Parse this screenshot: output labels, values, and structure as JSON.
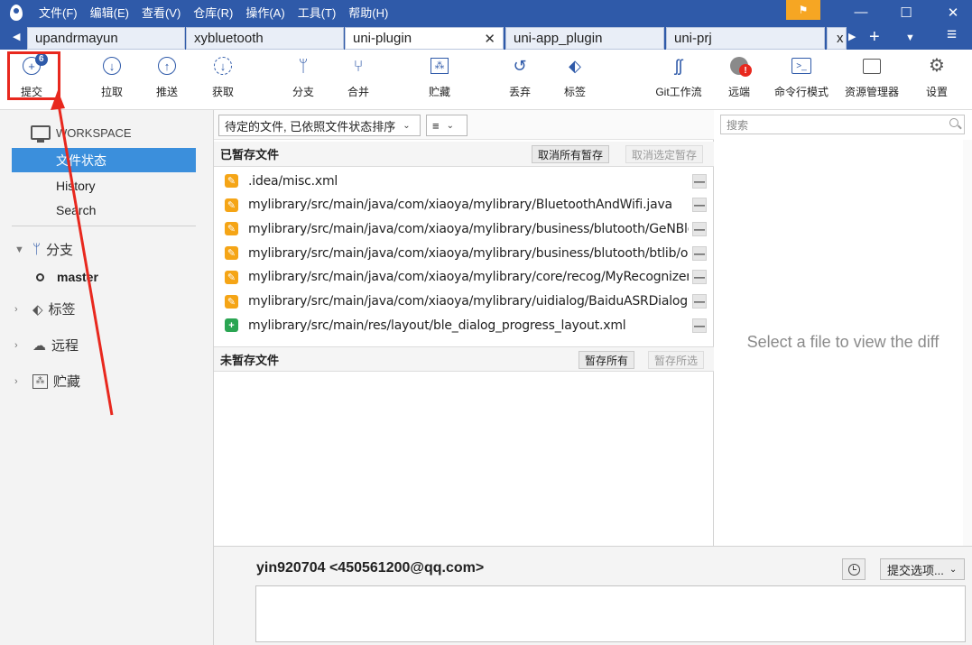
{
  "menu": [
    "文件(F)",
    "编辑(E)",
    "查看(V)",
    "仓库(R)",
    "操作(A)",
    "工具(T)",
    "帮助(H)"
  ],
  "window_buttons": {
    "minimize": "—",
    "maximize": "☐",
    "close": "✕"
  },
  "tabs": [
    {
      "label": "upandrmayun",
      "active": false
    },
    {
      "label": "xybluetooth",
      "active": false
    },
    {
      "label": "uni-plugin",
      "active": true
    },
    {
      "label": "uni-app_plugin",
      "active": false
    },
    {
      "label": "uni-prj",
      "active": false
    },
    {
      "label": "x",
      "active": false
    }
  ],
  "tab_close": "✕",
  "tab_menu_glyph": "≡",
  "toolbar": {
    "commit": "提交",
    "commit_badge": "6",
    "pull": "拉取",
    "push": "推送",
    "fetch": "获取",
    "branch": "分支",
    "merge": "合并",
    "stash": "贮藏",
    "discard": "丢弃",
    "tag": "标签",
    "git_flow": "Git工作流",
    "remote": "远端",
    "terminal": "命令行模式",
    "explorer": "资源管理器",
    "settings": "设置"
  },
  "sidebar": {
    "workspace": "WORKSPACE",
    "items": [
      "文件状态",
      "History",
      "Search"
    ],
    "branches": "分支",
    "current_branch": "master",
    "tags": "标签",
    "remotes": "远程",
    "stashes": "贮藏"
  },
  "filter": {
    "sort_select": "待定的文件, 已依照文件状态排序",
    "view_select": "≡"
  },
  "staged": {
    "title": "已暂存文件",
    "unstage_all": "取消所有暂存",
    "unstage_selected": "取消选定暂存",
    "files": [
      {
        "path": ".idea/misc.xml",
        "status": "modified"
      },
      {
        "path": "mylibrary/src/main/java/com/xiaoya/mylibrary/BluetoothAndWifi.java",
        "status": "modified"
      },
      {
        "path": "mylibrary/src/main/java/com/xiaoya/mylibrary/business/blutooth/GeNBle...",
        "status": "modified"
      },
      {
        "path": "mylibrary/src/main/java/com/xiaoya/mylibrary/business/blutooth/btlib/op...",
        "status": "modified"
      },
      {
        "path": "mylibrary/src/main/java/com/xiaoya/mylibrary/core/recog/MyRecognizer.j...",
        "status": "modified"
      },
      {
        "path": "mylibrary/src/main/java/com/xiaoya/mylibrary/uidialog/BaiduASRDialog.ja...",
        "status": "modified"
      },
      {
        "path": "mylibrary/src/main/res/layout/ble_dialog_progress_layout.xml",
        "status": "added"
      }
    ]
  },
  "unstaged": {
    "title": "未暂存文件",
    "stage_all": "暂存所有",
    "stage_selected": "暂存所选"
  },
  "search": {
    "placeholder": "搜索"
  },
  "diff": {
    "empty_message": "Select a file to view the diff"
  },
  "commit_area": {
    "author": "yin920704 <450561200@qq.com>",
    "options": "提交选项..."
  },
  "colors": {
    "accent": "#2f5aa9",
    "selection": "#3b8fdc",
    "modified": "#f5a516",
    "added": "#2aa552",
    "annotation": "#e8281e"
  }
}
